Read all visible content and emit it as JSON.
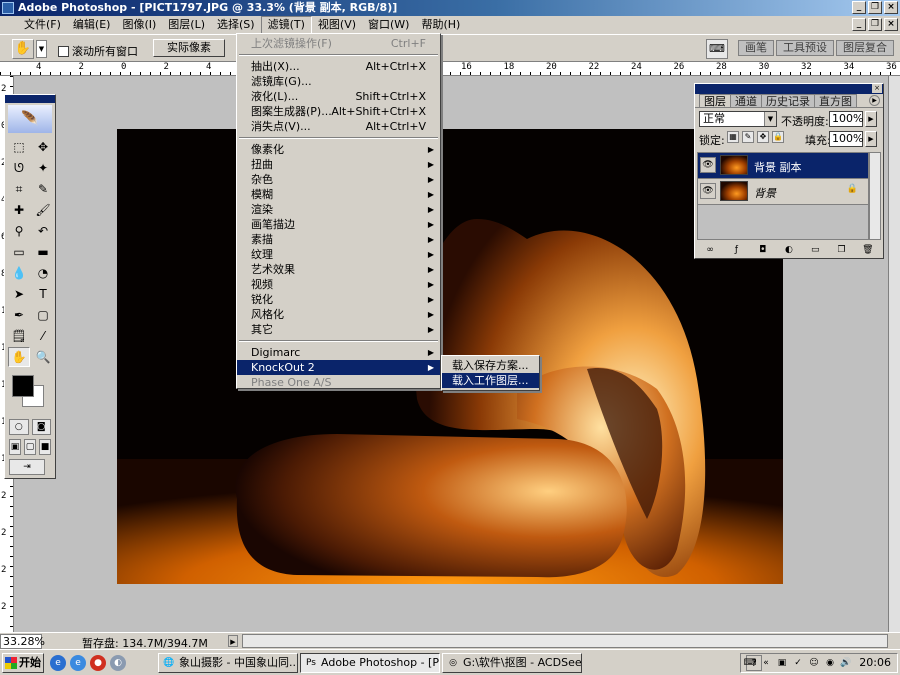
{
  "window": {
    "title": "Adobe Photoshop - [PICT1797.JPG @ 33.3% (背景 副本, RGB/8)]",
    "minimize_icon": "minimize-icon",
    "close_icon": "close-icon"
  },
  "menubar": {
    "items": [
      "文件(F)",
      "编辑(E)",
      "图像(I)",
      "图层(L)",
      "选择(S)",
      "滤镜(T)",
      "视图(V)",
      "窗口(W)",
      "帮助(H)"
    ]
  },
  "options": {
    "scroll_all_windows": "滚动所有窗口",
    "actual_pixels": "实际像素",
    "wells": [
      "画笔",
      "工具预设",
      "图层复合"
    ]
  },
  "ruler": {
    "top_ticks": [
      "4",
      "2",
      "0",
      "2",
      "4",
      "6",
      "8",
      "10",
      "12",
      "14",
      "16",
      "18",
      "20",
      "22",
      "24",
      "26",
      "28",
      "30",
      "32",
      "34",
      "36"
    ],
    "left_ticks": [
      "2",
      "0",
      "2",
      "4",
      "6",
      "8",
      "1",
      "1",
      "1",
      "1",
      "1",
      "2",
      "2",
      "2",
      "2"
    ]
  },
  "filter_menu": {
    "last_filter": {
      "label": "上次滤镜操作(F)",
      "shortcut": "Ctrl+F"
    },
    "group1": [
      {
        "label": "抽出(X)...",
        "shortcut": "Alt+Ctrl+X"
      },
      {
        "label": "滤镜库(G)...",
        "shortcut": ""
      },
      {
        "label": "液化(L)...",
        "shortcut": "Shift+Ctrl+X"
      },
      {
        "label": "图案生成器(P)...",
        "shortcut": "Alt+Shift+Ctrl+X"
      },
      {
        "label": "消失点(V)...",
        "shortcut": "Alt+Ctrl+V"
      }
    ],
    "group2": [
      "像素化",
      "扭曲",
      "杂色",
      "模糊",
      "渲染",
      "画笔描边",
      "素描",
      "纹理",
      "艺术效果",
      "视频",
      "锐化",
      "风格化",
      "其它"
    ],
    "group3": [
      "Digimarc",
      "KnockOut 2",
      "Phase One A/S"
    ]
  },
  "submenu": {
    "items": [
      "载入保存方案...",
      "载入工作图层..."
    ]
  },
  "layers_panel": {
    "tabs": [
      "图层",
      "通道",
      "历史记录",
      "直方图"
    ],
    "blend_mode": "正常",
    "opacity_label": "不透明度:",
    "opacity_value": "100%",
    "lock_label": "锁定:",
    "fill_label": "填充:",
    "fill_value": "100%",
    "layers": [
      {
        "name": "背景 副本",
        "selected": true
      },
      {
        "name": "背景",
        "selected": false
      }
    ]
  },
  "status": {
    "zoom": "33.28%",
    "scratch": "暂存盘: 134.7M/394.7M"
  },
  "taskbar": {
    "start": "开始",
    "tasks": [
      "象山摄影 - 中国象山同...",
      "Adobe Photoshop - [PIC...",
      "G:\\软件\\抠图 - ACDSee ..."
    ],
    "clock": "20:06"
  },
  "colors": {
    "title_bar": "#0a246a",
    "selection": "#0a246a",
    "chrome": "#d4d0c8"
  }
}
